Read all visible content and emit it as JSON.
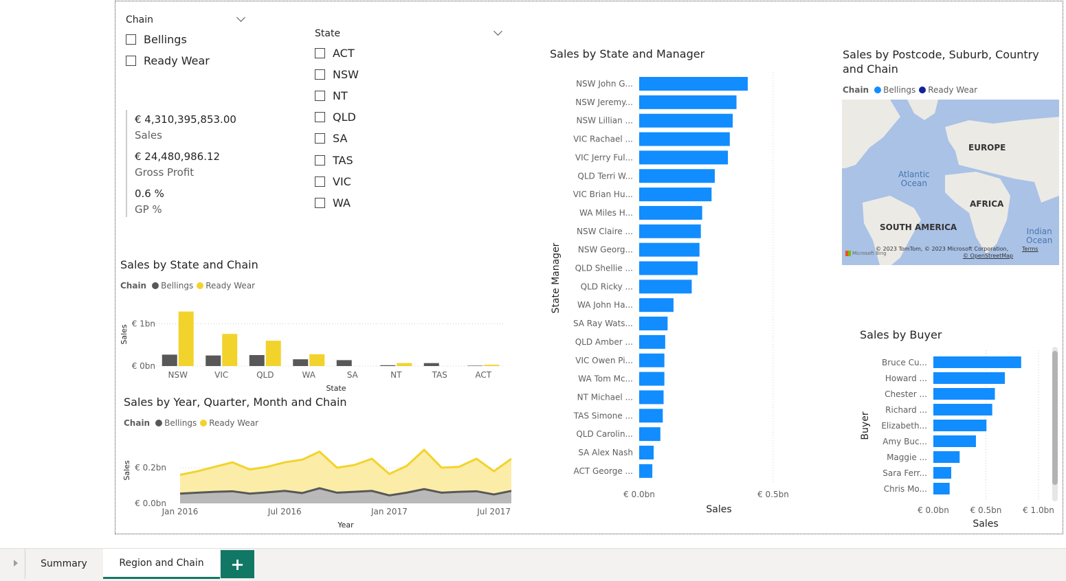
{
  "slicers": {
    "chain": {
      "title": "Chain",
      "options": [
        "Bellings",
        "Ready Wear"
      ]
    },
    "state": {
      "title": "State",
      "options": [
        "ACT",
        "NSW",
        "NT",
        "QLD",
        "SA",
        "TAS",
        "VIC",
        "WA"
      ]
    }
  },
  "kpis": [
    {
      "value": "€ 4,310,395,853.00",
      "label": "Sales"
    },
    {
      "value": "€ 24,480,986.12",
      "label": "Gross Profit"
    },
    {
      "value": "0.6 %",
      "label": "GP %"
    }
  ],
  "colors": {
    "bellings": "#585858",
    "ready_wear": "#f2d32c",
    "accent": "#118dff",
    "map_ready_wear": "#12239e",
    "tab_active": "#117865"
  },
  "legend": {
    "title": "Chain",
    "bellings": "Bellings",
    "ready_wear": "Ready Wear"
  },
  "chart_data": [
    {
      "id": "sales-by-state-chain",
      "type": "bar",
      "title": "Sales by State and Chain",
      "xlabel": "State",
      "ylabel": "Sales",
      "ytick_labels": [
        "€ 1bn",
        "€ 0bn"
      ],
      "ylim": [
        0,
        1.3
      ],
      "categories": [
        "NSW",
        "VIC",
        "QLD",
        "WA",
        "SA",
        "NT",
        "TAS",
        "ACT"
      ],
      "series": [
        {
          "name": "Bellings",
          "values": [
            0.27,
            0.25,
            0.26,
            0.16,
            0.14,
            0.02,
            0.07,
            0.01
          ]
        },
        {
          "name": "Ready Wear",
          "values": [
            1.29,
            0.76,
            0.6,
            0.28,
            0.0,
            0.07,
            0.0,
            0.03
          ]
        }
      ]
    },
    {
      "id": "sales-by-time-chain",
      "type": "area",
      "title": "Sales by Year, Quarter, Month and Chain",
      "xlabel": "Year",
      "ylabel": "Sales",
      "ytick_labels": [
        "€ 0.2bn",
        "€ 0.0bn"
      ],
      "xtick_labels": [
        "Jan 2016",
        "Jul 2016",
        "Jan 2017",
        "Jul 2017"
      ],
      "ylim": [
        0,
        0.3
      ],
      "x": [
        "2016-01",
        "2016-02",
        "2016-03",
        "2016-04",
        "2016-05",
        "2016-06",
        "2016-07",
        "2016-08",
        "2016-09",
        "2016-10",
        "2016-11",
        "2016-12",
        "2017-01",
        "2017-02",
        "2017-03",
        "2017-04",
        "2017-05",
        "2017-06",
        "2017-07",
        "2017-08"
      ],
      "series": [
        {
          "name": "Bellings",
          "values": [
            0.055,
            0.06,
            0.065,
            0.068,
            0.055,
            0.062,
            0.07,
            0.058,
            0.085,
            0.06,
            0.065,
            0.07,
            0.045,
            0.06,
            0.08,
            0.06,
            0.065,
            0.068,
            0.05,
            0.07
          ]
        },
        {
          "name": "Ready Wear",
          "values": [
            0.16,
            0.18,
            0.205,
            0.23,
            0.19,
            0.205,
            0.23,
            0.245,
            0.29,
            0.2,
            0.215,
            0.25,
            0.165,
            0.21,
            0.3,
            0.2,
            0.205,
            0.25,
            0.18,
            0.25
          ]
        }
      ]
    },
    {
      "id": "sales-by-state-manager",
      "type": "bar",
      "orientation": "horizontal",
      "title": "Sales by State and Manager",
      "xlabel": "Sales",
      "ylabel": "State Manager",
      "xtick_labels": [
        "€ 0.0bn",
        "€ 0.5bn"
      ],
      "xlim": [
        0,
        0.5
      ],
      "categories": [
        "NSW John G...",
        "NSW Jeremy...",
        "NSW Lillian ...",
        "VIC Rachael ...",
        "VIC Jerry Ful...",
        "QLD Terri W...",
        "VIC Brian Hu...",
        "WA Miles H...",
        "NSW Claire ...",
        "NSW Georg...",
        "QLD Shellie ...",
        "QLD Ricky ...",
        "WA John Ha...",
        "SA Ray Wats...",
        "QLD Amber ...",
        "VIC Owen Pi...",
        "WA Tom Mc...",
        "NT Michael ...",
        "TAS Simone ...",
        "QLD Carolin...",
        "SA Alex Nash",
        "ACT George ..."
      ],
      "values": [
        0.405,
        0.363,
        0.349,
        0.338,
        0.331,
        0.282,
        0.27,
        0.235,
        0.23,
        0.225,
        0.218,
        0.196,
        0.128,
        0.106,
        0.097,
        0.094,
        0.094,
        0.091,
        0.088,
        0.079,
        0.054,
        0.049
      ]
    },
    {
      "id": "sales-by-buyer",
      "type": "bar",
      "orientation": "horizontal",
      "title": "Sales by Buyer",
      "xlabel": "Sales",
      "ylabel": "Buyer",
      "xtick_labels": [
        "€ 0.0bn",
        "€ 0.5bn",
        "€ 1.0bn"
      ],
      "xlim": [
        0,
        1.0
      ],
      "categories": [
        "Bruce Cu...",
        "Howard ...",
        "Chester ...",
        "Richard ...",
        "Elizabeth...",
        "Amy Buc...",
        "Maggie ...",
        "Sara Ferr...",
        "Chris Mo..."
      ],
      "values": [
        0.835,
        0.68,
        0.585,
        0.56,
        0.505,
        0.405,
        0.25,
        0.17,
        0.155
      ]
    }
  ],
  "map": {
    "title": "Sales by Postcode, Suburb, Country and Chain",
    "legend_title": "Chain",
    "legend_items": [
      "Bellings",
      "Ready Wear"
    ],
    "labels": {
      "europe": "EUROPE",
      "africa": "AFRICA",
      "south_america": "SOUTH AMERICA",
      "atlantic": "Atlantic\nOcean",
      "indian": "Indian\nOcean"
    },
    "attribution": "© 2023 TomTom, © 2023 Microsoft Corporation,",
    "terms": "Terms",
    "osm": "© OpenStreetMap",
    "bing": "Microsoft Bing"
  },
  "tabs": {
    "items": [
      "Summary",
      "Region and Chain"
    ],
    "active": "Region and Chain",
    "add": "+"
  }
}
